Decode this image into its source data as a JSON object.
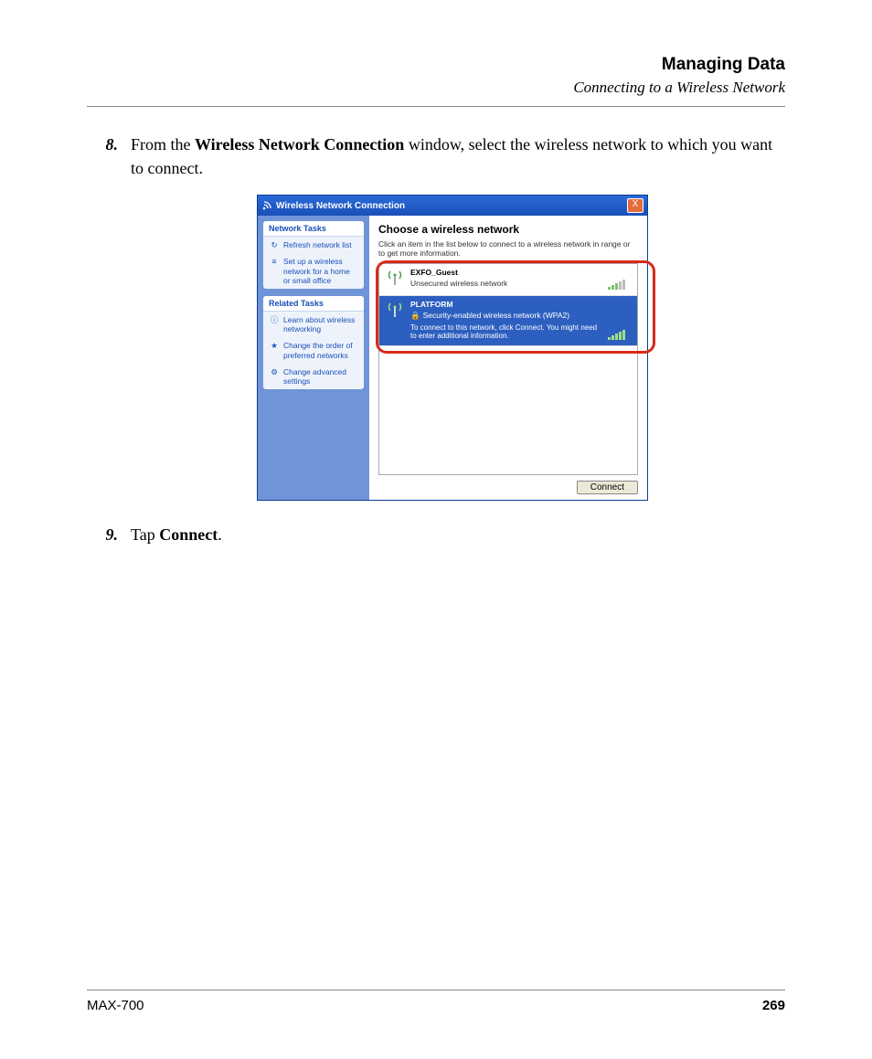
{
  "header": {
    "title": "Managing Data",
    "subtitle": "Connecting to a Wireless Network"
  },
  "step8": {
    "num": "8.",
    "pre": "From the ",
    "bold": "Wireless Network Connection",
    "post": " window, select the wireless network to which you want to connect."
  },
  "win": {
    "title": "Wireless Network Connection",
    "close": "X",
    "sidebar": {
      "box1_head": "Network Tasks",
      "box1_items": [
        {
          "icon": "↻",
          "label": "Refresh network list"
        },
        {
          "icon": "≡",
          "label": "Set up a wireless network for a home or small office"
        }
      ],
      "box2_head": "Related Tasks",
      "box2_items": [
        {
          "icon": "ⓘ",
          "label": "Learn about wireless networking"
        },
        {
          "icon": "★",
          "label": "Change the order of preferred networks"
        },
        {
          "icon": "⚙",
          "label": "Change advanced settings"
        }
      ]
    },
    "main": {
      "title": "Choose a wireless network",
      "sub": "Click an item in the list below to connect to a wireless network in range or to get more information.",
      "net1": {
        "name": "EXFO_Guest",
        "desc": "Unsecured wireless network"
      },
      "net2": {
        "name": "PLATFORM",
        "desc": "Security-enabled wireless network (WPA2)",
        "info": "To connect to this network, click Connect. You might need to enter additional information."
      },
      "connect": "Connect"
    }
  },
  "step9": {
    "num": "9.",
    "pre": "Tap ",
    "bold": "Connect",
    "post": "."
  },
  "footer": {
    "model": "MAX-700",
    "page": "269"
  }
}
